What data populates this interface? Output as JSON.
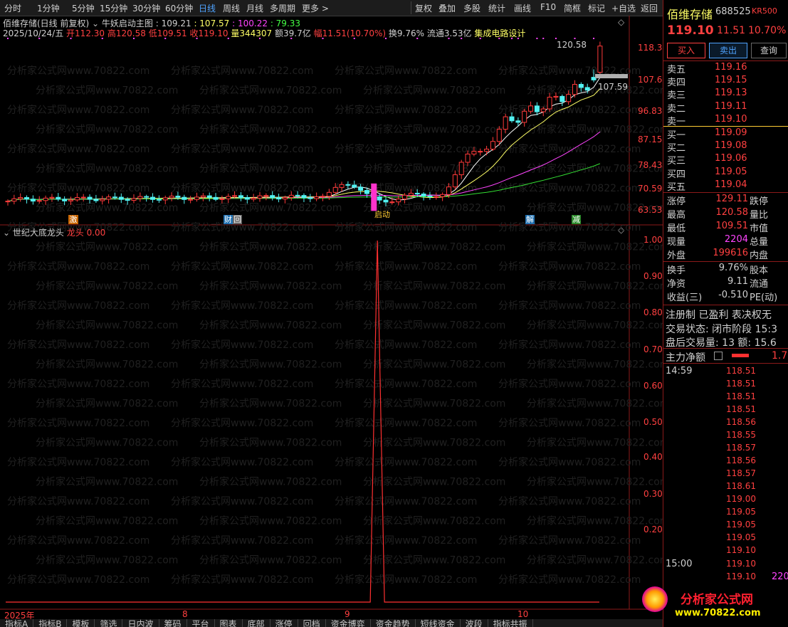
{
  "toolbar": {
    "left_items": [
      "分时",
      "1分钟",
      "5分钟",
      "15分钟",
      "30分钟",
      "60分钟",
      "日线",
      "周线",
      "月线",
      "多周期",
      "更多 >"
    ],
    "active": "日线",
    "right_items": [
      "复权",
      "叠加",
      "多股",
      "统计",
      "画线",
      "F10",
      "简框",
      "标记",
      "+自选",
      "返回"
    ]
  },
  "header": {
    "title": "佰维存储(日线 前复权)",
    "indicator_name": "牛妖启动主图",
    "ind_v1": ": 109.21",
    "ind_v2": ": 107.57",
    "ind_v3": ": 100.22",
    "ind_v4": ": 79.33",
    "date": "2025/10/24/五",
    "open": "开112.30",
    "high": "高120.58",
    "low": "低109.51",
    "close": "收119.10",
    "volume": "量344307",
    "amount": "额39.7亿",
    "range": "幅11.51(10.70%)",
    "turnover": "换9.76%",
    "float": "流通3.53亿",
    "concept": "集成电路设计"
  },
  "main_axis": [
    "118.3",
    "107.6",
    "96.83",
    "87.15",
    "78.43",
    "70.59",
    "63.53"
  ],
  "price_annotations": {
    "high_label": "120.58",
    "ma_label": "107.59"
  },
  "events": {
    "e1": "激",
    "e2": "财",
    "e3": "回",
    "e4": "解",
    "e5": "减",
    "start": "启动"
  },
  "sub": {
    "title": "世纪大底龙头",
    "series": "龙头",
    "value": "0.00",
    "axis": [
      "1.00",
      "0.90",
      "0.80",
      "0.70",
      "0.60",
      "0.50",
      "0.40",
      "0.30",
      "0.20"
    ]
  },
  "time_axis": [
    "2025年",
    "8",
    "9",
    "10"
  ],
  "bottom_tabs": [
    "指标A",
    "指标B",
    "模板",
    "筛选",
    "日内波",
    "筹码",
    "平台",
    "图表",
    "底部",
    "涨停",
    "回档",
    "资金博弈",
    "资金趋势",
    "短线资金",
    "波段",
    "指标共振"
  ],
  "quote": {
    "name": "佰维存储",
    "code": "688525",
    "badge": "KR500",
    "price": "119.10",
    "change": "11.51",
    "pct": "10.70%",
    "buy_btn": "买入",
    "sell_btn": "卖出",
    "query_btn": "查询",
    "asks": [
      {
        "label": "卖五",
        "price": "119.16"
      },
      {
        "label": "卖四",
        "price": "119.15"
      },
      {
        "label": "卖三",
        "price": "119.13"
      },
      {
        "label": "卖二",
        "price": "119.11"
      },
      {
        "label": "卖一",
        "price": "119.10"
      }
    ],
    "bids": [
      {
        "label": "买一",
        "price": "119.09"
      },
      {
        "label": "买二",
        "price": "119.08"
      },
      {
        "label": "买三",
        "price": "119.06"
      },
      {
        "label": "买四",
        "price": "119.05"
      },
      {
        "label": "买五",
        "price": "119.04"
      }
    ],
    "stats": [
      {
        "l": "涨停",
        "v": "129.11",
        "r": "跌停"
      },
      {
        "l": "最高",
        "v": "120.58",
        "r": "量比"
      },
      {
        "l": "最低",
        "v": "109.51",
        "r": "市值"
      },
      {
        "l": "现量",
        "v": "2204",
        "r": "总量"
      },
      {
        "l": "外盘",
        "v": "199616",
        "r": "内盘"
      }
    ],
    "stats2": [
      {
        "l": "换手",
        "v": "9.76%",
        "r": "股本"
      },
      {
        "l": "净资",
        "v": "9.11",
        "r": "流通"
      },
      {
        "l": "收益(三)",
        "v": "-0.510",
        "r": "PE(动)"
      }
    ],
    "reg": "注册制 已盈利 表决权无",
    "trade_status": "交易状态: 闭市阶段 15:3",
    "after_hours": "盘后交易量: 13  额: 15.6",
    "main_flow": "主力净额",
    "main_flow_val": "1.7",
    "ticks_time1": "14:59",
    "ticks": [
      "118.51",
      "118.51",
      "118.51",
      "118.51",
      "118.56",
      "118.55",
      "118.57",
      "118.56",
      "118.57",
      "118.61",
      "119.00",
      "119.05",
      "119.05",
      "119.05",
      "119.10"
    ],
    "ticks_time2": "15:00",
    "ticks2": [
      "119.10",
      "119.10"
    ],
    "last_vol": "220"
  },
  "logo": {
    "name": "分析家公式网",
    "url": "www.70822.com"
  },
  "watermark": "分析家公式网www.70822.com"
}
